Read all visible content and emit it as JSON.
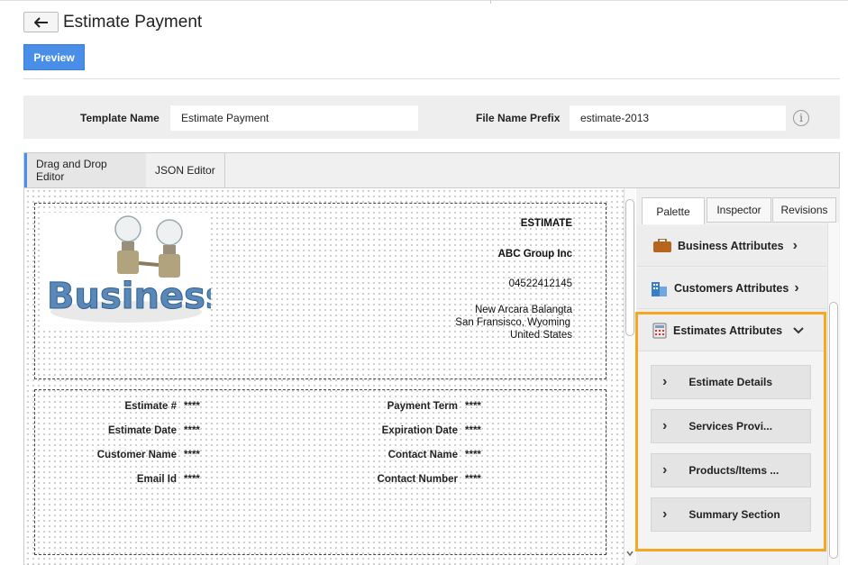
{
  "header": {
    "back_icon": "arrow-left-icon",
    "title": "Estimate Payment",
    "preview_label": "Preview"
  },
  "template_bar": {
    "template_name_label": "Template Name",
    "template_name_value": "Estimate Payment",
    "file_prefix_label": "File Name Prefix",
    "file_prefix_value": "estimate-2013",
    "info_icon": "info-icon"
  },
  "editor_tabs": [
    {
      "label": "Drag and Drop Editor",
      "active": true
    },
    {
      "label": "JSON Editor",
      "active": false
    }
  ],
  "document": {
    "heading": "ESTIMATE",
    "company": "ABC Group Inc",
    "phone": "04522412145",
    "address_line1": "New Arcara Balangta",
    "address_line2": "San Fransisco, Wyoming",
    "address_line3": "United States",
    "logo_text": "Business",
    "fields_left": [
      {
        "label": "Estimate #",
        "value": "****"
      },
      {
        "label": "Estimate Date",
        "value": "****"
      },
      {
        "label": "Customer Name",
        "value": "****"
      },
      {
        "label": "Email Id",
        "value": "****"
      }
    ],
    "fields_right": [
      {
        "label": "Payment Term",
        "value": "****"
      },
      {
        "label": "Expiration Date",
        "value": "****"
      },
      {
        "label": "Contact Name",
        "value": "****"
      },
      {
        "label": "Contact Number",
        "value": "****"
      }
    ]
  },
  "right_panel": {
    "tabs": [
      {
        "label": "Palette",
        "active": true
      },
      {
        "label": "Inspector",
        "active": false
      },
      {
        "label": "Revisions",
        "active": false
      }
    ],
    "accordions": [
      {
        "label": "Business Attributes",
        "icon": "briefcase-icon",
        "expanded": false
      },
      {
        "label": "Customers Attributes",
        "icon": "buildings-icon",
        "expanded": false
      },
      {
        "label": "Estimates Attributes",
        "icon": "calculator-icon",
        "expanded": true
      }
    ],
    "estimate_items": [
      {
        "label": "Estimate Details"
      },
      {
        "label": "Services Provi..."
      },
      {
        "label": "Products/Items ..."
      },
      {
        "label": "Summary Section"
      }
    ],
    "highlight_color": "#f5a623"
  }
}
